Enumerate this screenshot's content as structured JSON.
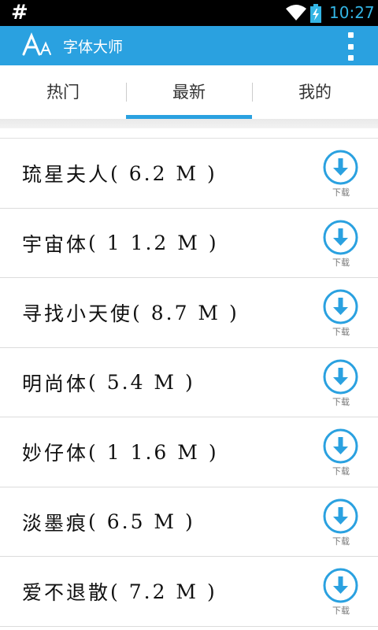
{
  "status_bar": {
    "left_symbol": "#",
    "time": "10:27",
    "icons": [
      "wifi-icon",
      "battery-charging-icon"
    ]
  },
  "action_bar": {
    "logo_text": "AA",
    "title": "字体大师",
    "menu_icon": "overflow-menu-icon"
  },
  "tabs": [
    {
      "label": "热门",
      "selected": false
    },
    {
      "label": "最新",
      "selected": true
    },
    {
      "label": "我的",
      "selected": false
    }
  ],
  "fonts": [
    {
      "name": "琉星夫人",
      "size": "( 6.2 M )"
    },
    {
      "name": "宇宙体",
      "size": "( 1 1.2 M )"
    },
    {
      "name": "寻找小天使",
      "size": "( 8.7 M )"
    },
    {
      "name": "明尚体",
      "size": "( 5.4 M )"
    },
    {
      "name": "妙仔体",
      "size": "( 1 1.6 M )"
    },
    {
      "name": "淡墨痕",
      "size": "( 6.5 M )"
    },
    {
      "name": "爱不退散",
      "size": "( 7.2 M )"
    }
  ],
  "download_label": "下载",
  "colors": {
    "accent": "#2aa1e0",
    "status_time": "#33b5e5",
    "download_icon": "#2aa1e0"
  }
}
